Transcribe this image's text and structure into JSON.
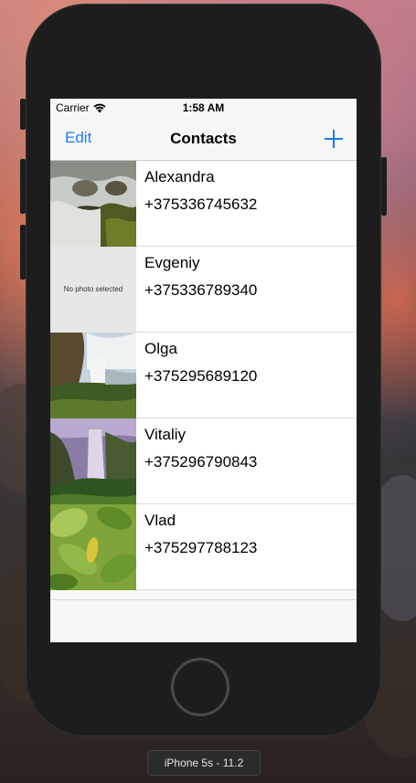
{
  "device_label": "iPhone 5s - 11.2",
  "status_bar": {
    "carrier": "Carrier",
    "time": "1:58 AM"
  },
  "nav": {
    "edit_label": "Edit",
    "title": "Contacts",
    "add_icon": "plus-icon"
  },
  "contacts": [
    {
      "name": "Alexandra",
      "phone": "+375336745632",
      "photo": "waterfall-rocks-photo"
    },
    {
      "name": "Evgeniy",
      "phone": "+375336789340",
      "photo": "placeholder",
      "placeholder_text": "No photo selected"
    },
    {
      "name": "Olga",
      "phone": "+375295689120",
      "photo": "waterfall-cliff-photo"
    },
    {
      "name": "Vitaliy",
      "phone": "+375296790843",
      "photo": "waterfall-purple-photo"
    },
    {
      "name": "Vlad",
      "phone": "+375297788123",
      "photo": "green-leaves-photo"
    }
  ],
  "colors": {
    "accent": "#1a7cf5",
    "bar_background": "#f7f7f7",
    "separator": "#d9d9dc"
  }
}
